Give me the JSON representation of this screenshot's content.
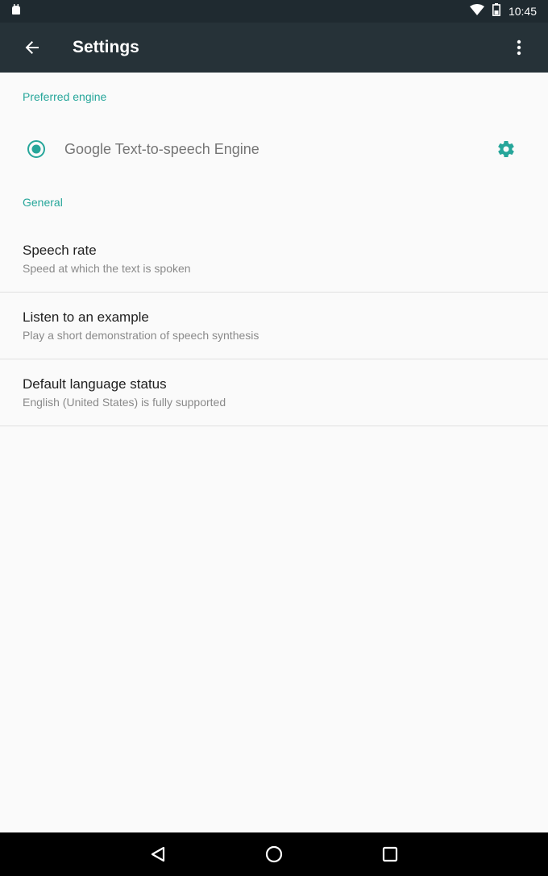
{
  "status_bar": {
    "time": "10:45",
    "icons": [
      "android-notification-icon",
      "wifi-icon",
      "battery-icon"
    ]
  },
  "app_bar": {
    "title": "Settings",
    "back_icon": "back-arrow-icon",
    "overflow_icon": "more-vert-icon"
  },
  "sections": {
    "preferred_engine": {
      "header": "Preferred engine",
      "engine_label": "Google Text-to-speech Engine",
      "selected": true
    },
    "general": {
      "header": "General",
      "items": [
        {
          "title": "Speech rate",
          "summary": "Speed at which the text is spoken"
        },
        {
          "title": "Listen to an example",
          "summary": "Play a short demonstration of speech synthesis"
        },
        {
          "title": "Default language status",
          "summary": "English (United States) is fully supported"
        }
      ]
    }
  },
  "colors": {
    "accent": "#26a69a",
    "app_bar": "#263238",
    "status_bar": "#1f2a30",
    "background": "#fafafa"
  },
  "nav_bar": {
    "icons": [
      "nav-back-icon",
      "nav-home-icon",
      "nav-recents-icon"
    ]
  }
}
